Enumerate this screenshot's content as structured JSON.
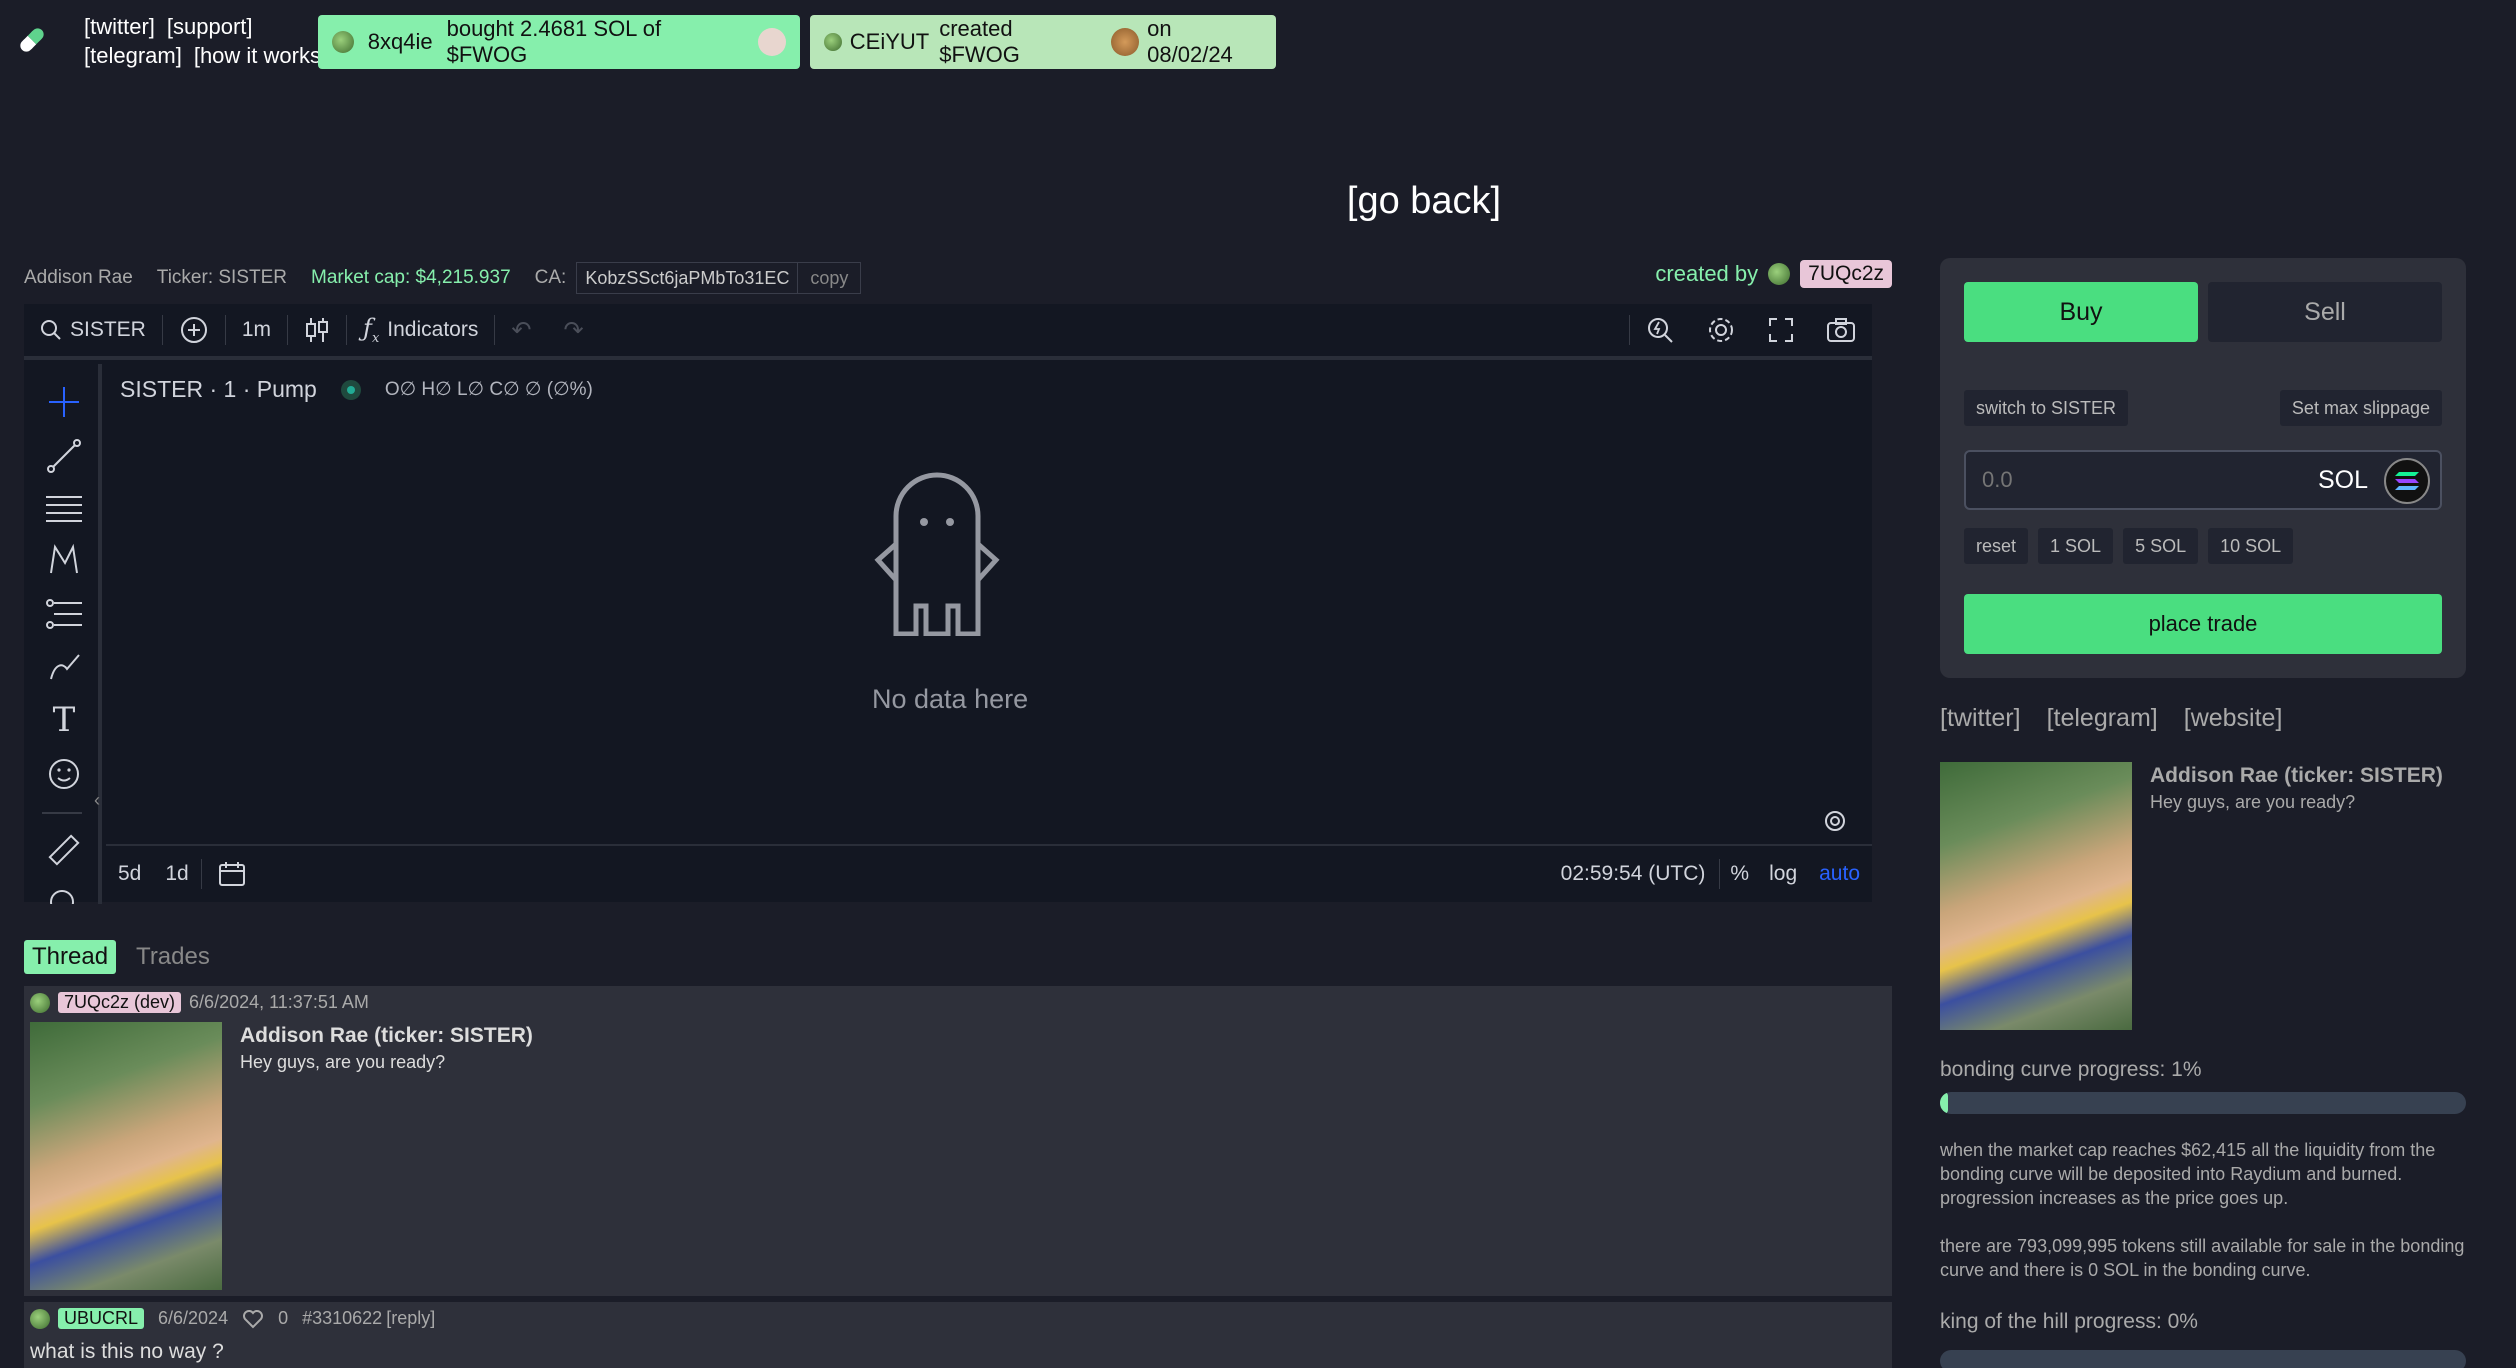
{
  "header": {
    "nav": [
      "[twitter]",
      "[support]",
      "[telegram]",
      "[how it works]"
    ],
    "ticker_buy": {
      "user": "8xq4ie",
      "text": "bought 2.4681 SOL of $FWOG"
    },
    "ticker_create": {
      "user": "CEiYUT",
      "text": "created $FWOG",
      "date": "on 08/02/24"
    }
  },
  "go_back": "[go back]",
  "token": {
    "name": "Addison Rae",
    "ticker": "Ticker: SISTER",
    "market_cap": "Market cap: $4,215.937",
    "ca_label": "CA:",
    "ca_value": "KobzSSct6jaPMbTo31EC",
    "copy": "copy",
    "created_by": "created by",
    "creator": "7UQc2z"
  },
  "chart": {
    "symbol": "SISTER",
    "interval": "1m",
    "indicators": "Indicators",
    "legend_title": "SISTER · 1 · Pump",
    "ohlc": "O∅ H∅ L∅ C∅ ∅ (∅%)",
    "no_data": "No data here",
    "range_5d": "5d",
    "range_1d": "1d",
    "time": "02:59:54 (UTC)",
    "pct": "%",
    "log": "log",
    "auto": "auto"
  },
  "tabs": {
    "thread": "Thread",
    "trades": "Trades"
  },
  "posts": [
    {
      "user": "7UQc2z (dev)",
      "time": "6/6/2024, 11:37:51 AM",
      "title": "Addison Rae (ticker: SISTER)",
      "body": "Hey guys, are you ready?"
    },
    {
      "user": "UBUCRL",
      "time": "6/6/2024",
      "likes": "0",
      "id": "#3310622",
      "reply": "[reply]",
      "body": "what is this no way ?"
    }
  ],
  "trade_panel": {
    "buy": "Buy",
    "sell": "Sell",
    "switch": "switch to SISTER",
    "slippage": "Set max slippage",
    "amount_placeholder": "0.0",
    "currency": "SOL",
    "presets": [
      "reset",
      "1 SOL",
      "5 SOL",
      "10 SOL"
    ],
    "place": "place trade"
  },
  "links": [
    "[twitter]",
    "[telegram]",
    "[website]"
  ],
  "info": {
    "title": "Addison Rae (ticker: SISTER)",
    "desc": "Hey guys, are you ready?",
    "bonding_label": "bonding curve progress: 1%",
    "bonding_value": 1,
    "bonding_text": "when the market cap reaches $62,415 all the liquidity from the bonding curve will be deposited into Raydium and burned. progression increases as the price goes up.",
    "tokens_text": "there are 793,099,995 tokens still available for sale in the bonding curve and there is 0 SOL in the bonding curve.",
    "koth_label": "king of the hill progress: 0%",
    "koth_value": 0
  },
  "colors": {
    "accent": "#86efac",
    "buy": "#4ade80",
    "bg": "#1b1d28",
    "panel": "#2e303a"
  }
}
